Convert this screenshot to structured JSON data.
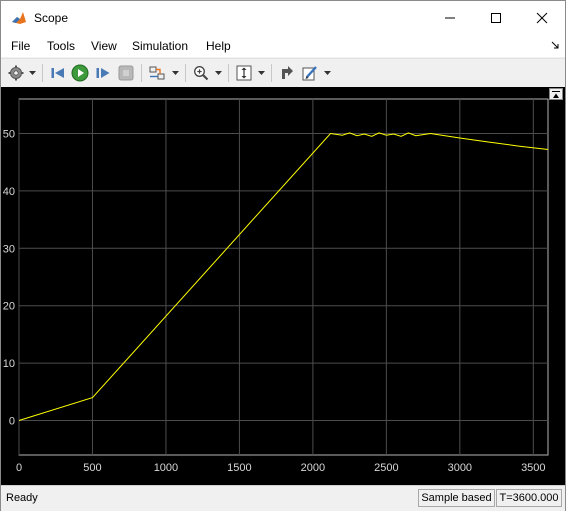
{
  "window": {
    "title": "Scope"
  },
  "menu": {
    "file": "File",
    "tools": "Tools",
    "view": "View",
    "simulation": "Simulation",
    "help": "Help"
  },
  "toolbar": {
    "icons": [
      "gear-icon",
      "step-back-icon",
      "run-icon",
      "step-forward-icon",
      "stop-icon",
      "signal-selector-icon",
      "zoom-icon",
      "autoscale-icon",
      "highlight-block-icon",
      "edit-icon"
    ]
  },
  "chart_data": {
    "type": "line",
    "title": "",
    "xlabel": "",
    "ylabel": "",
    "xlim": [
      0,
      3600
    ],
    "ylim": [
      -6,
      56
    ],
    "xticks": [
      0,
      500,
      1000,
      1500,
      2000,
      2500,
      3000,
      3500
    ],
    "yticks": [
      0,
      10,
      20,
      30,
      40,
      50
    ],
    "grid": true,
    "line_color": "#ffff00",
    "background": "#000000",
    "series": [
      {
        "x": [
          0,
          500,
          2120,
          2200,
          2250,
          2300,
          2350,
          2400,
          2450,
          2500,
          2550,
          2600,
          2650,
          2700,
          2750,
          2800,
          3000,
          3200,
          3400,
          3600
        ],
        "y": [
          0,
          4,
          50,
          49.7,
          50.1,
          49.6,
          49.9,
          49.5,
          50.1,
          49.7,
          49.9,
          49.5,
          50.1,
          49.6,
          49.8,
          50,
          49.2,
          48.5,
          47.8,
          47.2
        ]
      }
    ]
  },
  "status": {
    "ready": "Ready",
    "sample_mode": "Sample based",
    "time": "T=3600.000"
  }
}
